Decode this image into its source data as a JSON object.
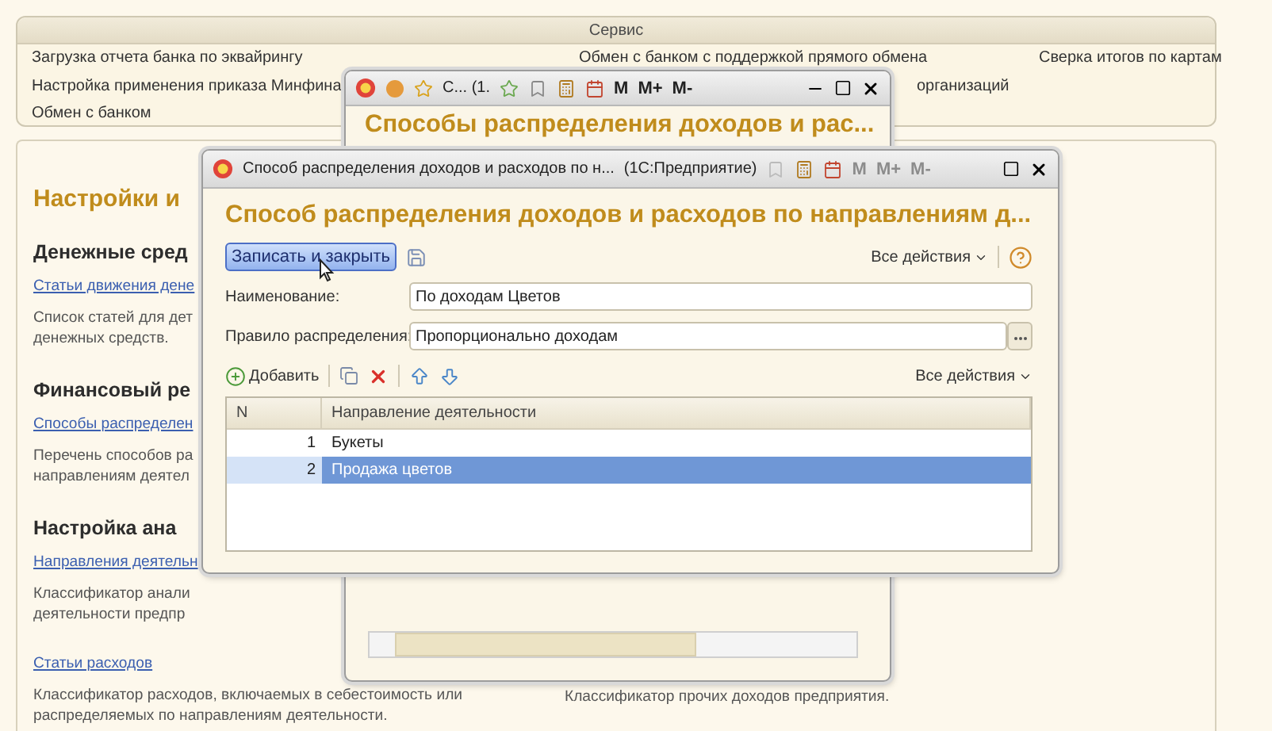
{
  "service": {
    "title": "Сервис",
    "columns": [
      [
        "Загрузка отчета банка по эквайрингу",
        "Настройка применения приказа Минфина",
        "Обмен с банком"
      ],
      [
        "Обмен с банком с поддержкой прямого обмена",
        "организаций"
      ],
      [
        "Сверка итогов по картам"
      ]
    ]
  },
  "settings": {
    "title": "Настройки и",
    "sections": [
      {
        "heading": "Денежные сред",
        "link": "Статьи движения дене",
        "description": [
          "Список статей для дет",
          "денежных средств."
        ]
      },
      {
        "heading": "Финансовый ре",
        "link": "Способы распределен",
        "description": [
          "Перечень способов ра",
          "направлениям деятел"
        ]
      },
      {
        "heading": "Настройка ана",
        "link": "Направления деятельн",
        "description": [
          "Классификатор анали",
          "деятельности предпр"
        ]
      }
    ],
    "bottom": [
      {
        "link": "Статьи расходов",
        "description": [
          "Классификатор расходов, включаемых в себестоимость или",
          "распределяемых по направлениям деятельности."
        ]
      },
      {
        "description": [
          "Классификатор прочих доходов предприятия."
        ]
      }
    ]
  },
  "back_window": {
    "toolbar_title": "С... (1.",
    "memory": {
      "labels": [
        "M",
        "M+",
        "M-"
      ],
      "disabled": false
    },
    "heading": "Способы распределения доходов и рас..."
  },
  "front_window": {
    "title": "Способ распределения доходов и расходов по н...",
    "app": "(1С:Предприятие)",
    "memory": {
      "labels": [
        "M",
        "M+",
        "M-"
      ],
      "disabled": true
    },
    "heading": "Способ распределения доходов и расходов по направлениям д...",
    "save_close": "Записать и закрыть",
    "all_actions": "Все действия",
    "fields": [
      {
        "label": "Наименование:",
        "value": "По доходам Цветов",
        "kind": "text"
      },
      {
        "label": "Правило распределения:",
        "value": "Пропорционально доходам",
        "kind": "choice"
      }
    ],
    "add": "Добавить",
    "table_all_actions": "Все действия",
    "table": {
      "columns": [
        "N",
        "Направление деятельности"
      ],
      "rows": [
        {
          "n": "1",
          "name": "Букеты",
          "selected": false
        },
        {
          "n": "2",
          "name": "Продажа цветов",
          "selected": true
        }
      ]
    }
  }
}
